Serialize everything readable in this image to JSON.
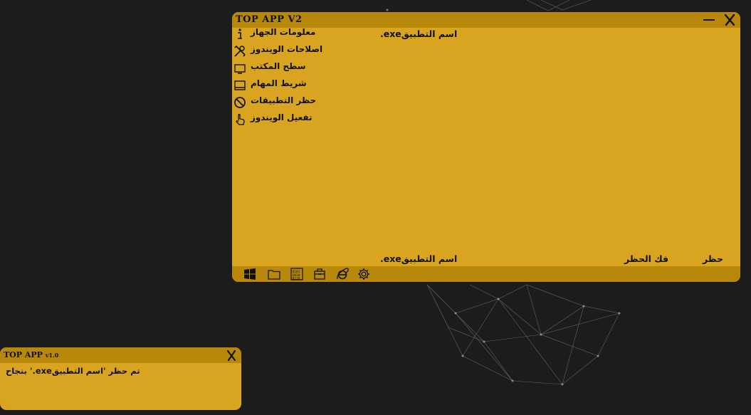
{
  "main_window": {
    "title": "TOP APP V2",
    "minimize_glyph": "—",
    "close_glyph": "X",
    "menu": [
      {
        "label": "معلومات الجهاز",
        "icon": "info-icon"
      },
      {
        "label": "اصلاحات الويندوز",
        "icon": "tools-icon"
      },
      {
        "label": "سطح المكتب",
        "icon": "desktop-icon"
      },
      {
        "label": "شريط المهام",
        "icon": "taskbar-icon"
      },
      {
        "label": "حظر التطبيقات",
        "icon": "block-icon"
      },
      {
        "label": "تفعيل الويندوز",
        "icon": "hand-pointer-icon"
      }
    ],
    "app_name_label": ".exeاسم التطبيق",
    "app_name_input": ".exeاسم التطبيق",
    "unblock_label": "فك الحظر",
    "block_label": "حظر",
    "bottom_icons": [
      "windows-logo-icon",
      "folder-icon",
      "binary-icon",
      "toolbox-icon",
      "internet-explorer-icon",
      "settings-icon"
    ]
  },
  "notify_window": {
    "title": "TOP APP",
    "version": "v1.0",
    "close_glyph": "X",
    "message": "بنجاح '.exeتم حظر 'اسم التطبيق"
  },
  "colors": {
    "background": "#1c1c1c",
    "window": "#d9a520",
    "titlebar": "#b8880a",
    "text": "#111111"
  }
}
